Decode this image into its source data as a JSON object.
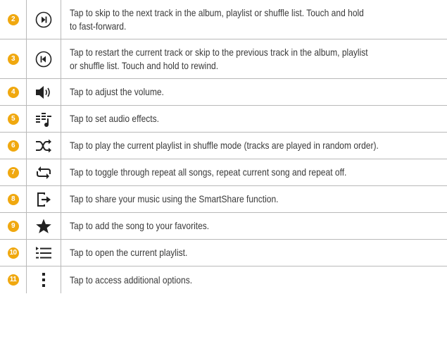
{
  "rows": [
    {
      "num": "2",
      "icon": "next-track-icon",
      "text": "Tap to skip to the next track in the album, playlist or shuffle list. Touch and hold to fast-forward.",
      "line1": "Tap to skip to the next track in the album, playlist or shuffle list. Touch and hold",
      "line2": "to fast-forward."
    },
    {
      "num": "3",
      "icon": "previous-track-icon",
      "text": "Tap to restart the current track or skip to the previous track in the album, playlist or shuffle list. Touch and hold to rewind.",
      "line1": "Tap to restart the current track or skip to the previous track in the album, playlist",
      "line2": "or shuffle list. Touch and hold to rewind."
    },
    {
      "num": "4",
      "icon": "volume-icon",
      "text": "Tap to adjust the volume."
    },
    {
      "num": "5",
      "icon": "audio-effects-icon",
      "text": "Tap to set audio effects."
    },
    {
      "num": "6",
      "icon": "shuffle-icon",
      "text": "Tap to play the current playlist in shuffle mode (tracks are played in random order)."
    },
    {
      "num": "7",
      "icon": "repeat-icon",
      "text": "Tap to toggle through repeat all songs, repeat current song and repeat off."
    },
    {
      "num": "8",
      "icon": "share-icon",
      "text": "Tap to share your music using the SmartShare function."
    },
    {
      "num": "9",
      "icon": "star-icon",
      "text": "Tap to add the song to your favorites."
    },
    {
      "num": "10",
      "icon": "playlist-icon",
      "text": "Tap to open the current playlist."
    },
    {
      "num": "11",
      "icon": "more-options-icon",
      "text": "Tap to access additional options."
    }
  ],
  "colors": {
    "badge": "#f0a80f",
    "icon": "#222222",
    "rule": "#b9b9b9"
  }
}
